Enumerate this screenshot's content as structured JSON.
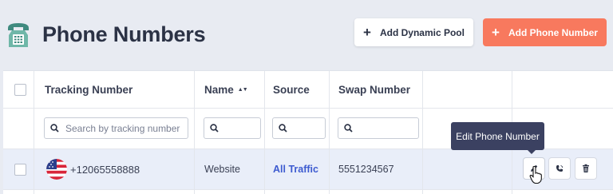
{
  "header": {
    "title": "Phone Numbers",
    "icon": "telephone-icon",
    "add_pool_label": "Add Dynamic Pool",
    "add_number_label": "Add Phone Number",
    "plus_glyph": "+"
  },
  "table": {
    "columns": [
      "Tracking Number",
      "Name",
      "Source",
      "Swap Number"
    ],
    "sort_glyph": "▲▼",
    "search_placeholder": "Search by tracking number",
    "rows": [
      {
        "tracking_number": "+12065558888",
        "name": "Website",
        "source": "All Traffic",
        "swap_number": "5551234567",
        "country_flag": "us-flag-icon"
      }
    ]
  },
  "tooltip": {
    "text": "Edit Phone Number"
  },
  "colors": {
    "accent": "#f8795e",
    "link": "#3d5bd0",
    "tooltip_bg": "#3b4161",
    "row_highlight": "#e9eef9"
  }
}
